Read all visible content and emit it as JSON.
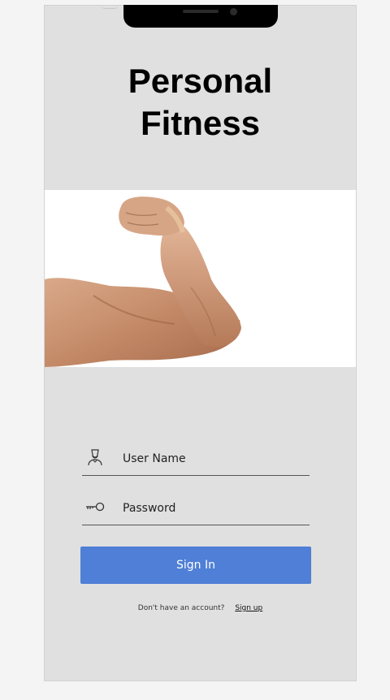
{
  "app": {
    "title_line1": "Personal",
    "title_line2": "Fitness"
  },
  "hero": {
    "image_description": "flexed-bicep-arm"
  },
  "form": {
    "username": {
      "placeholder": "User Name",
      "icon": "user-icon"
    },
    "password": {
      "placeholder": "Password",
      "icon": "key-icon"
    },
    "sign_in_label": "Sign In",
    "no_account_text": "Don't have an account?",
    "sign_up_label": "Sign up"
  },
  "colors": {
    "background": "#e0e0e0",
    "primary_button": "#4f7fd6",
    "page": "#f4f4f4"
  }
}
